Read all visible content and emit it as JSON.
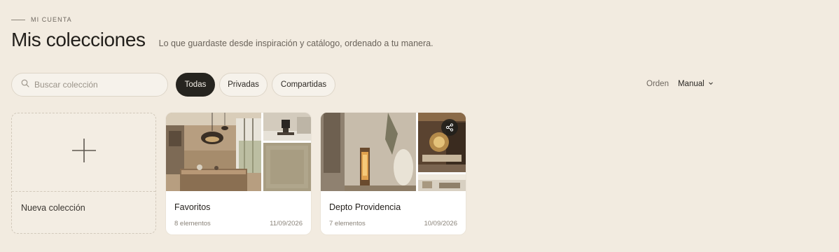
{
  "header": {
    "eyebrow": "MI CUENTA",
    "title": "Mis colecciones",
    "subtitle": "Lo que guardaste desde inspiración y catálogo, ordenado a tu manera."
  },
  "toolbar": {
    "search_placeholder": "Buscar colección",
    "search_value": "",
    "filters": [
      "Todas",
      "Privadas",
      "Compartidas"
    ],
    "active_filter": "Todas",
    "order_label": "Orden",
    "order_value": "Manual"
  },
  "new_collection": {
    "label": "Nueva colección"
  },
  "collections": [
    {
      "name": "Favoritos",
      "count": "8 elementos",
      "date": "11/09/2026",
      "shared": false
    },
    {
      "name": "Depto Providencia",
      "count": "7 elementos",
      "date": "10/09/2026",
      "shared": true
    }
  ],
  "icons": {
    "search": "search-icon",
    "chevron": "chevron-down-icon",
    "plus": "plus-icon",
    "share": "share-icon"
  },
  "colors": {
    "background": "#f2ebe0",
    "active_chip": "#26241f",
    "card": "#ffffff"
  }
}
